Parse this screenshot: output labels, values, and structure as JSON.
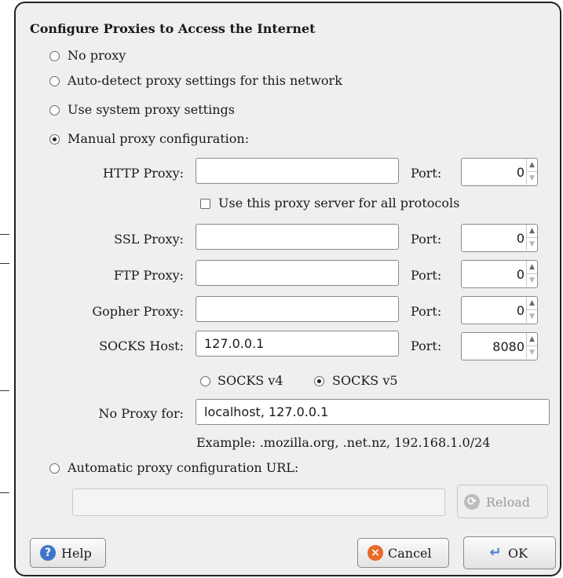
{
  "dialog": {
    "title": "Configure Proxies to Access the Internet",
    "options": {
      "no_proxy": "No proxy",
      "auto_detect": "Auto-detect proxy settings for this network",
      "system": "Use system proxy settings",
      "manual": "Manual proxy configuration:",
      "automatic_url": "Automatic proxy configuration URL:"
    },
    "selected_option": "manual",
    "http": {
      "label": "HTTP Proxy:",
      "value": "",
      "port_label": "Port:",
      "port": "0"
    },
    "use_for_all": "Use this proxy server for all protocols",
    "ssl": {
      "label": "SSL Proxy:",
      "value": "",
      "port_label": "Port:",
      "port": "0"
    },
    "ftp": {
      "label": "FTP Proxy:",
      "value": "",
      "port_label": "Port:",
      "port": "0"
    },
    "gopher": {
      "label": "Gopher Proxy:",
      "value": "",
      "port_label": "Port:",
      "port": "0"
    },
    "socks": {
      "label": "SOCKS Host:",
      "value": "127.0.0.1",
      "port_label": "Port:",
      "port": "8080"
    },
    "socks_v4": "SOCKS v4",
    "socks_v5": "SOCKS v5",
    "socks_selected": "v5",
    "no_proxy_for": {
      "label": "No Proxy for:",
      "value": "localhost, 127.0.0.1"
    },
    "example": "Example: .mozilla.org, .net.nz, 192.168.1.0/24",
    "auto_url_value": "",
    "reload": "Reload",
    "buttons": {
      "help": "Help",
      "cancel": "Cancel",
      "ok": "OK"
    }
  }
}
